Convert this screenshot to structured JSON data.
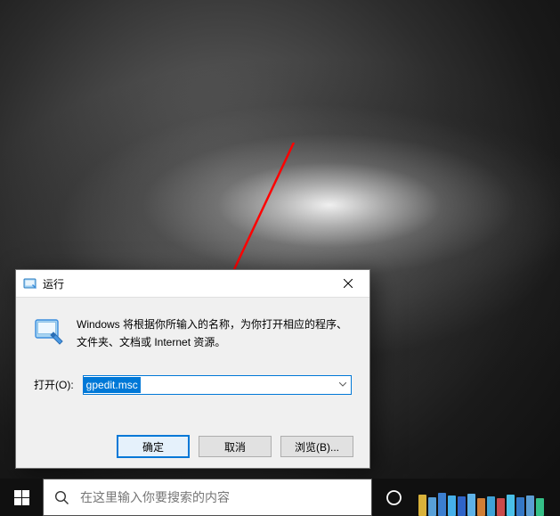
{
  "dialog": {
    "title": "运行",
    "description": "Windows 将根据你所输入的名称，为你打开相应的程序、文件夹、文档或 Internet 资源。",
    "open_label": "打开(O):",
    "input_value": "gpedit.msc",
    "buttons": {
      "ok": "确定",
      "cancel": "取消",
      "browse": "浏览(B)..."
    }
  },
  "taskbar": {
    "search_placeholder": "在这里输入你要搜索的内容"
  }
}
